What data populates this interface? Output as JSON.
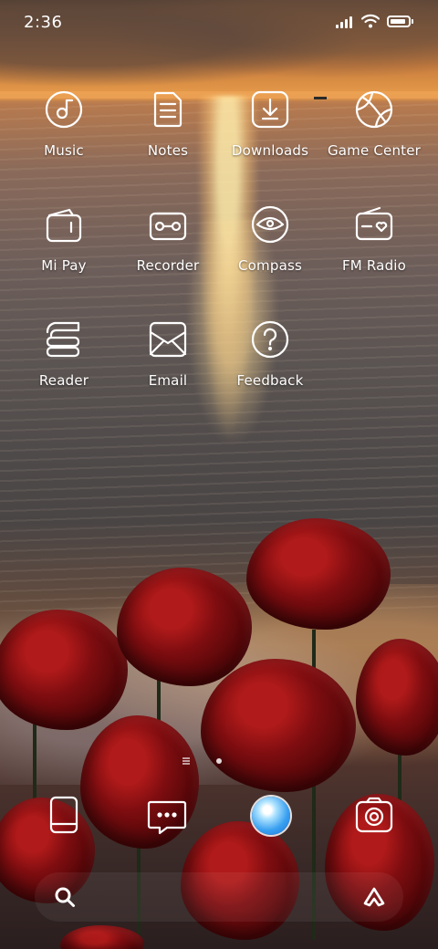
{
  "status_bar": {
    "time": "2:36",
    "signal_icon": "cellular-signal-icon",
    "wifi_icon": "wifi-icon",
    "battery_icon": "battery-icon"
  },
  "apps": [
    {
      "label": "Music",
      "icon": "music-icon"
    },
    {
      "label": "Notes",
      "icon": "notes-icon"
    },
    {
      "label": "Downloads",
      "icon": "downloads-icon"
    },
    {
      "label": "Game Center",
      "icon": "game-center-icon"
    },
    {
      "label": "Mi Pay",
      "icon": "wallet-icon"
    },
    {
      "label": "Recorder",
      "icon": "recorder-icon"
    },
    {
      "label": "Compass",
      "icon": "compass-icon"
    },
    {
      "label": "FM Radio",
      "icon": "radio-icon"
    },
    {
      "label": "Reader",
      "icon": "reader-icon"
    },
    {
      "label": "Email",
      "icon": "email-icon"
    },
    {
      "label": "Feedback",
      "icon": "feedback-icon"
    }
  ],
  "dock": {
    "apps": [
      {
        "icon": "phone-icon"
      },
      {
        "icon": "messages-icon"
      },
      {
        "icon": "browser-icon"
      },
      {
        "icon": "camera-icon"
      }
    ],
    "search_icon": "search-icon",
    "assistant_icon": "assistant-icon"
  },
  "wallpaper": "sunset sea with red roses",
  "colors": {
    "icon_stroke": "#ffffff",
    "browser_blue": "#3aa0f0"
  }
}
